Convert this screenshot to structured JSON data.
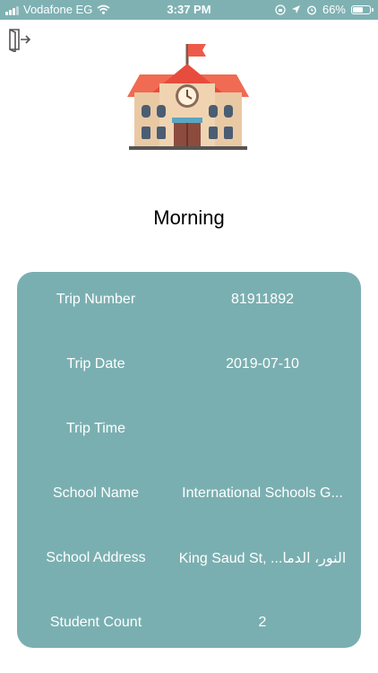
{
  "status_bar": {
    "carrier": "Vodafone EG",
    "time": "3:37 PM",
    "battery": "66%",
    "battery_level": 0.66,
    "icons": [
      "signal-bars",
      "wifi",
      "screen-rotation-lock",
      "location-arrow",
      "alarm-clock",
      "battery"
    ]
  },
  "header": {
    "logout_icon": "exit-door-icon"
  },
  "illustration": {
    "icon": "school-building-with-flag-and-clock"
  },
  "trip": {
    "title": "Morning"
  },
  "details": [
    {
      "label": "Trip Number",
      "value": "81911892"
    },
    {
      "label": "Trip Date",
      "value": "2019-07-10"
    },
    {
      "label": "Trip Time",
      "value": ""
    },
    {
      "label": "School Name",
      "value": "International Schools G..."
    },
    {
      "label": "School Address",
      "value": "King Saud St, ...النور، الدما"
    },
    {
      "label": "Student Count",
      "value": "2"
    }
  ],
  "colors": {
    "accent": "#7aafb1",
    "status_bar": "#7fb1b3",
    "card_text": "#ffffff"
  }
}
